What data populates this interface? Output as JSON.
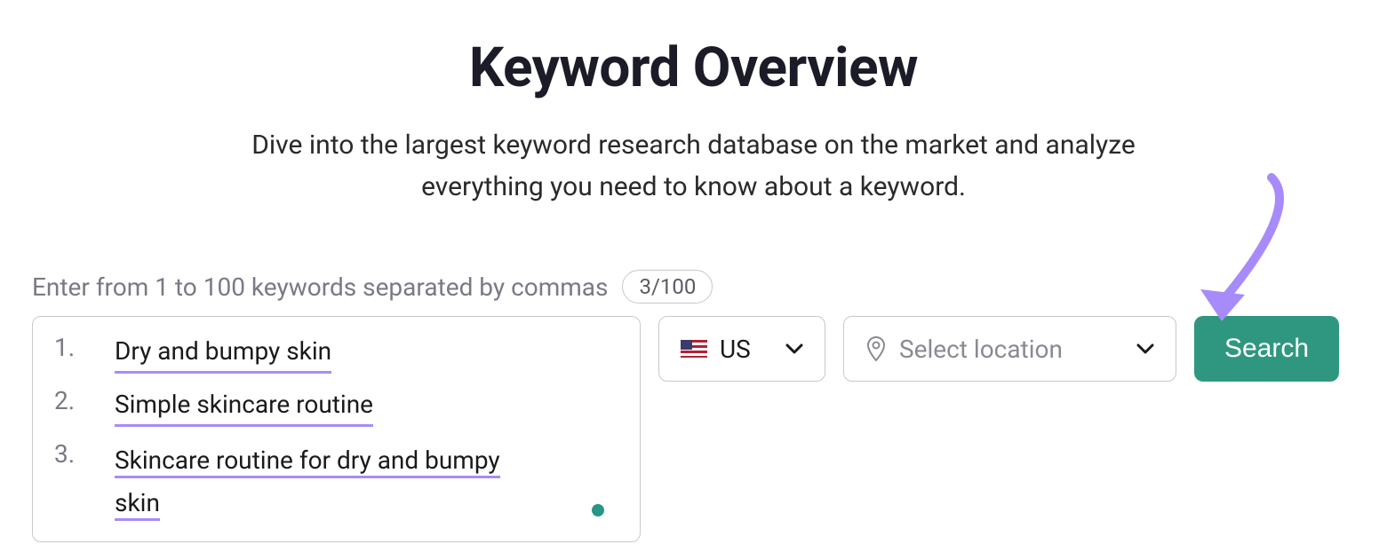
{
  "header": {
    "title": "Keyword Overview",
    "subtitle": "Dive into the largest keyword research database on the market and analyze everything you need to know about a keyword."
  },
  "input": {
    "hint": "Enter from 1 to 100 keywords separated by commas",
    "count_badge": "3/100",
    "keywords": [
      {
        "num": "1.",
        "text": "Dry and bumpy skin"
      },
      {
        "num": "2.",
        "text": "Simple skincare routine"
      },
      {
        "num": "3.",
        "text_line1": "Skincare routine for dry and bumpy",
        "text_line2": "skin"
      }
    ]
  },
  "country": {
    "label": "US"
  },
  "location": {
    "placeholder": "Select location"
  },
  "actions": {
    "search_label": "Search"
  },
  "colors": {
    "accent_green": "#2f977f",
    "annotation_purple": "#a78bfa"
  }
}
